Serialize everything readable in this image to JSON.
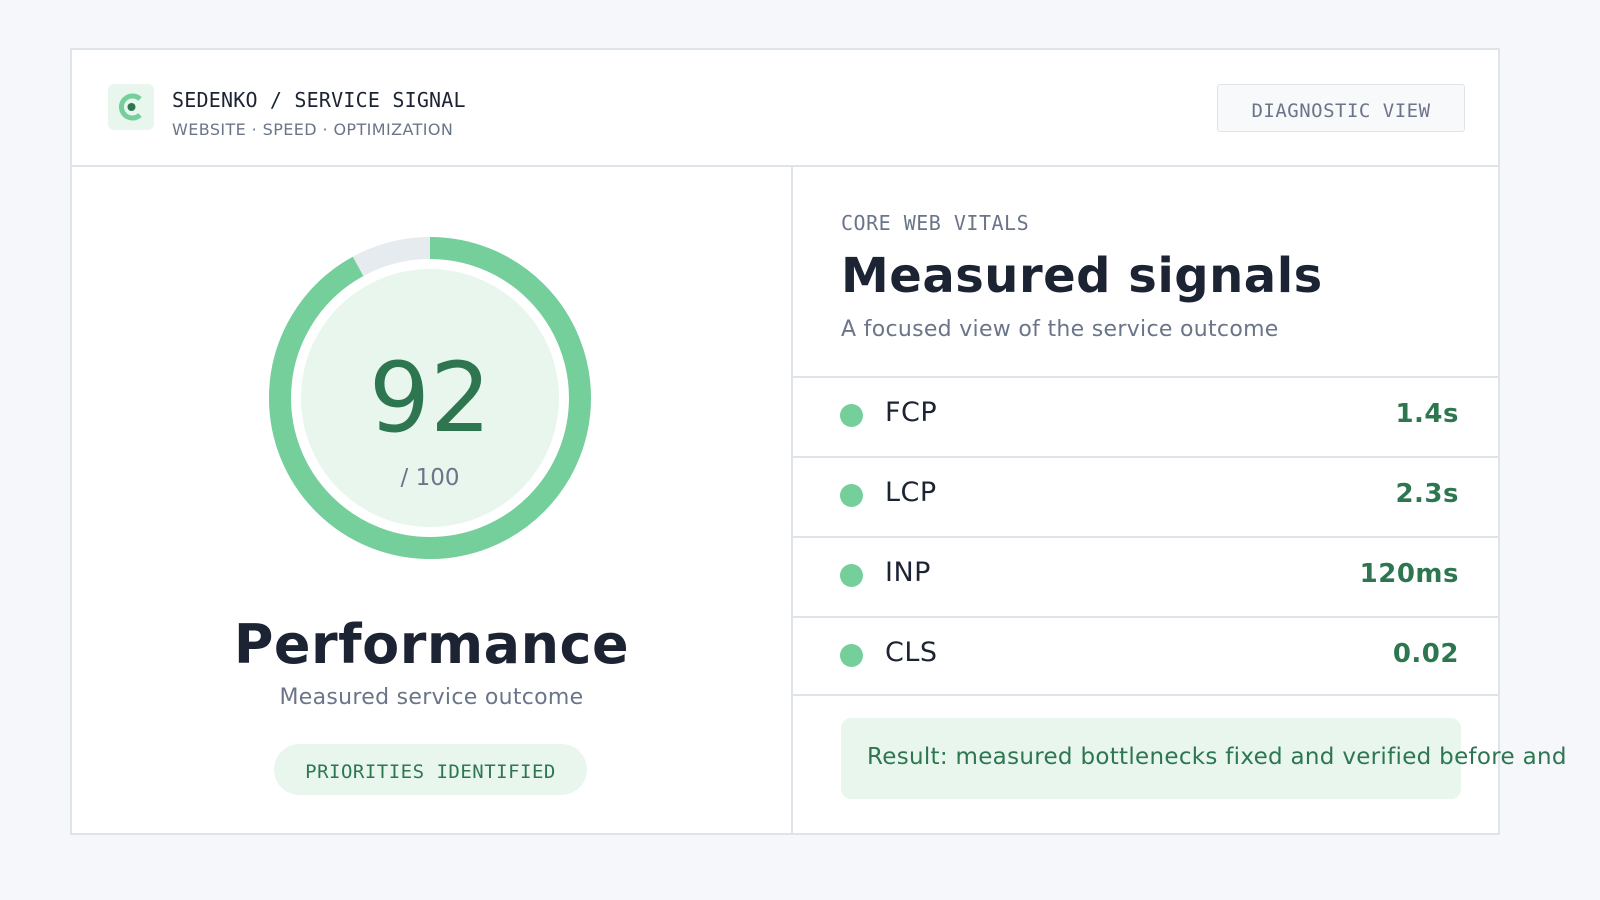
{
  "header": {
    "brand_title": "SEDENKO / SERVICE SIGNAL",
    "brand_subtitle": "WEBSITE · SPEED · OPTIMIZATION",
    "diagnostic_button": "DIAGNOSTIC VIEW",
    "logo_icon": "c-logo-icon"
  },
  "score_panel": {
    "score": "92",
    "score_max": "/ 100",
    "score_fraction": 0.92,
    "title": "Performance",
    "subtitle": "Measured service outcome",
    "badge": "PRIORITIES IDENTIFIED"
  },
  "vitals_panel": {
    "eyebrow": "CORE WEB VITALS",
    "title": "Measured signals",
    "subtitle": "A focused view of the service outcome",
    "metrics": [
      {
        "label": "FCP",
        "value": "1.4s"
      },
      {
        "label": "LCP",
        "value": "2.3s"
      },
      {
        "label": "INP",
        "value": "120ms"
      },
      {
        "label": "CLS",
        "value": "0.02"
      }
    ],
    "result": "Result: measured bottlenecks fixed and verified before and"
  },
  "colors": {
    "accent": "#74cf9b",
    "accent_dark": "#2d7650",
    "accent_bg": "#e8f6ee",
    "text": "#1c2434",
    "muted": "#6b7589",
    "border": "#dfe3ea",
    "background": "#f5f7fa"
  }
}
